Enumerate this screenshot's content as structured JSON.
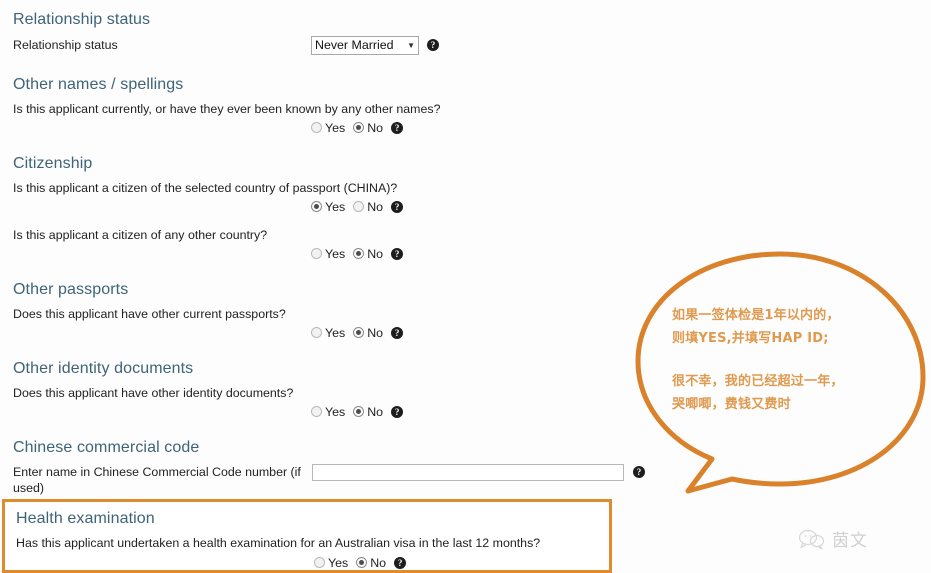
{
  "page": {
    "background_color": "#fdfdfd",
    "heading_color": "#3f6378",
    "accent_orange": "#e08b2e",
    "bubble_text_color": "#e09a4f"
  },
  "sections": {
    "relationship_status": {
      "heading": "Relationship status",
      "question_label": "Relationship status",
      "select_value": "Never Married",
      "select_arrow": "▼",
      "help": "?"
    },
    "other_names": {
      "heading": "Other names / spellings",
      "question_label": "Is this applicant currently, or have they ever been known by any other names?",
      "options": [
        "Yes",
        "No"
      ],
      "selected": "No",
      "help": "?"
    },
    "citizenship": {
      "heading": "Citizenship",
      "question1": {
        "label": "Is this applicant a citizen of the selected country of passport (CHINA)?",
        "options": [
          "Yes",
          "No"
        ],
        "selected": "Yes",
        "help": "?"
      },
      "question2": {
        "label": "Is this applicant a citizen of any other country?",
        "options": [
          "Yes",
          "No"
        ],
        "selected": "No",
        "help": "?"
      }
    },
    "other_passports": {
      "heading": "Other passports",
      "question_label": "Does this applicant have other current passports?",
      "options": [
        "Yes",
        "No"
      ],
      "selected": "No",
      "help": "?"
    },
    "other_identity_documents": {
      "heading": "Other identity documents",
      "question_label": "Does this applicant have other identity documents?",
      "options": [
        "Yes",
        "No"
      ],
      "selected": "No",
      "help": "?"
    },
    "chinese_commercial_code": {
      "heading": "Chinese commercial code",
      "question_label": "Enter name in Chinese Commercial Code number (if used)",
      "input_value": "",
      "input_placeholder": "",
      "help": "?"
    },
    "health_examination": {
      "heading": "Health examination",
      "question_label": "Has this applicant undertaken a health examination for an Australian visa in the last 12 months?",
      "options": [
        "Yes",
        "No"
      ],
      "selected": "No",
      "help": "?",
      "highlight_color": "#e08b2e"
    }
  },
  "annotation_bubble": {
    "line1": "如果一签体检是1年以内的，",
    "line2": "则填YES,并填写HAP ID;",
    "line3": "很不幸，我的已经超过一年，",
    "line4": "哭唧唧，费钱又费时"
  },
  "watermark": {
    "icon": "wechat-chat-bubble-icon",
    "text": "茵文"
  }
}
